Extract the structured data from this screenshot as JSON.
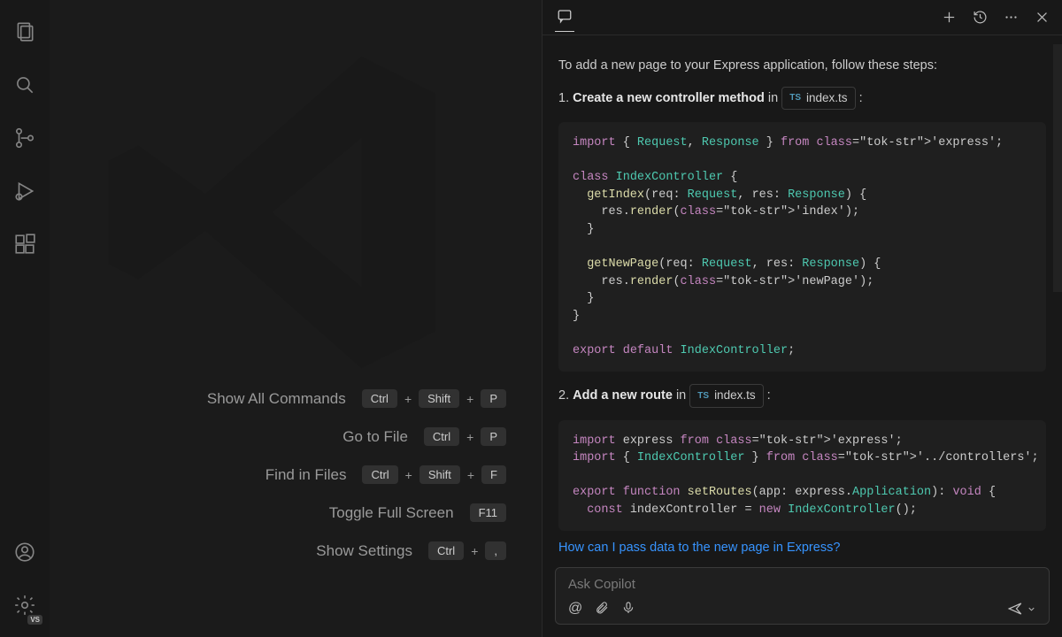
{
  "activity_bar": {
    "items": [
      "explorer",
      "search",
      "source-control",
      "run-debug",
      "extensions"
    ],
    "bottom": [
      "accounts",
      "manage"
    ],
    "manage_badge": "VS"
  },
  "welcome": {
    "commands": [
      {
        "label": "Show All Commands",
        "keys": [
          "Ctrl",
          "Shift",
          "P"
        ]
      },
      {
        "label": "Go to File",
        "keys": [
          "Ctrl",
          "P"
        ]
      },
      {
        "label": "Find in Files",
        "keys": [
          "Ctrl",
          "Shift",
          "F"
        ]
      },
      {
        "label": "Toggle Full Screen",
        "keys": [
          "F11"
        ]
      },
      {
        "label": "Show Settings",
        "keys": [
          "Ctrl",
          ","
        ]
      }
    ]
  },
  "chat": {
    "intro": "To add a new page to your Express application, follow these steps:",
    "step1": {
      "num": "1.",
      "bold": "Create a new controller method",
      "rest": "in",
      "file": "index.ts"
    },
    "code1": "import { Request, Response } from 'express';\n\nclass IndexController {\n  getIndex(req: Request, res: Response) {\n    res.render('index');\n  }\n\n  getNewPage(req: Request, res: Response) {\n    res.render('newPage');\n  }\n}\n\nexport default IndexController;",
    "step2": {
      "num": "2.",
      "bold": "Add a new route",
      "rest": "in",
      "file": "index.ts"
    },
    "code2": "import express from 'express';\nimport { IndexController } from '../controllers';\n\nexport function setRoutes(app: express.Application): void {\n  const indexController = new IndexController();",
    "suggestion": "How can I pass data to the new page in Express?",
    "input_placeholder": "Ask Copilot"
  }
}
